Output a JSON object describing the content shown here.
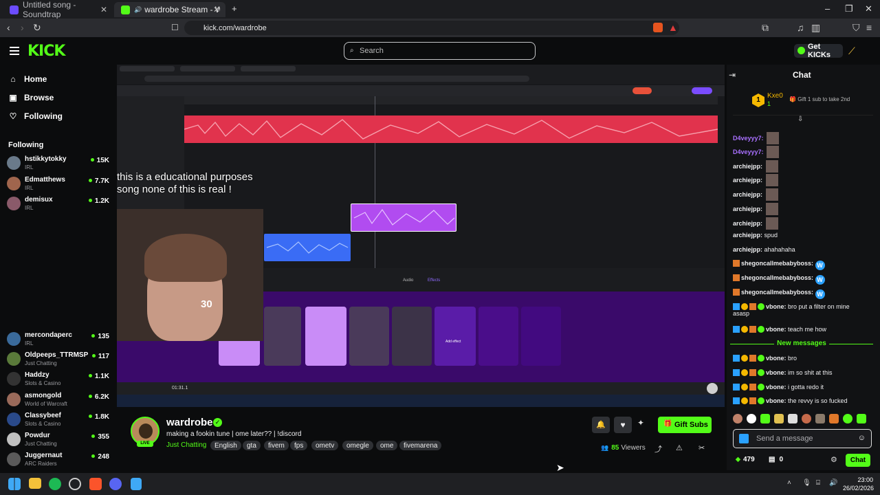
{
  "browser": {
    "tabs": [
      {
        "title": "Untitled song - Soundtrap",
        "active": false
      },
      {
        "title": "wardrobe Stream - Watch Li",
        "active": true
      }
    ],
    "url": "kick.com/wardrobe"
  },
  "header": {
    "logo": "KICK",
    "search_placeholder": "Search",
    "get_kicks_label": "Get KICKs"
  },
  "sidebar": {
    "nav": [
      {
        "label": "Home",
        "icon": "home-icon"
      },
      {
        "label": "Browse",
        "icon": "browse-icon"
      },
      {
        "label": "Following",
        "icon": "heart-icon"
      }
    ],
    "following_heading": "Following",
    "channels": [
      {
        "name": "hstikkytokky",
        "category": "IRL",
        "viewers": "15K",
        "color": "#6a7a8a"
      },
      {
        "name": "Edmatthews",
        "category": "IRL",
        "viewers": "7.7K",
        "color": "#a0654d"
      },
      {
        "name": "demisux",
        "category": "IRL",
        "viewers": "1.2K",
        "color": "#8a5a6a"
      },
      {
        "name": "mercondaperc",
        "category": "IRL",
        "viewers": "135",
        "color": "#3a6a9a"
      },
      {
        "name": "Oldpeeps_TTRMSP",
        "category": "Just Chatting",
        "viewers": "117",
        "color": "#5a7a3a"
      },
      {
        "name": "Haddzy",
        "category": "Slots & Casino",
        "viewers": "1.1K",
        "color": "#333333"
      },
      {
        "name": "asmongold",
        "category": "World of Warcraft",
        "viewers": "6.2K",
        "color": "#9a6a5a"
      },
      {
        "name": "Classybeef",
        "category": "Slots & Casino",
        "viewers": "1.8K",
        "color": "#2a4a8a"
      },
      {
        "name": "Powdur",
        "category": "Just Chatting",
        "viewers": "355",
        "color": "#c0c0c0"
      },
      {
        "name": "Juggernaut",
        "category": "ARC Raiders",
        "viewers": "248",
        "color": "#5a5a5a"
      }
    ]
  },
  "player": {
    "overlay_line1": "this is a educational purposes",
    "overlay_line2": "song none of this is real !",
    "timer_fragment": "30",
    "daw_time": "01:31.1",
    "daw_tab_audio": "Audio",
    "daw_tab_effects": "Effects",
    "add_effect": "Add effect"
  },
  "stream": {
    "streamer": "wardrobe",
    "title": "making a fookin tune | ome later?? | !discord",
    "category": "Just Chatting",
    "tags": [
      "English",
      "gta",
      "fivem",
      "fps",
      "ometv",
      "omegle",
      "ome",
      "fivemarena"
    ],
    "viewers_count": "85",
    "viewers_label": "Viewers",
    "live_badge": "LIVE",
    "gift_subs_label": "Gift Subs"
  },
  "chat": {
    "title": "Chat",
    "top_gifter": {
      "name": "Kxe0",
      "count": "1",
      "message": "Gift 1 sub to take 2nd"
    },
    "messages": [
      {
        "user": "D4veyyy7:",
        "text": "",
        "emote": true,
        "color": "#a970ff"
      },
      {
        "user": "D4veyyy7:",
        "text": "",
        "emote": true,
        "color": "#a970ff"
      },
      {
        "user": "archiejpp:",
        "text": "",
        "emote": true,
        "color": "#efeff1"
      },
      {
        "user": "archiejpp:",
        "text": "",
        "emote": true,
        "color": "#efeff1"
      },
      {
        "user": "archiejpp:",
        "text": "",
        "emote": true,
        "color": "#efeff1"
      },
      {
        "user": "archiejpp:",
        "text": "",
        "emote": true,
        "color": "#efeff1"
      },
      {
        "user": "archiejpp:",
        "text": "",
        "emote": true,
        "color": "#efeff1"
      },
      {
        "user": "archiejpp:",
        "text": "spud",
        "emote": false,
        "color": "#efeff1"
      },
      {
        "user": "archiejpp:",
        "text": "ahahahaha",
        "emote": false,
        "color": "#efeff1"
      },
      {
        "user": "shegoncallmebabyboss:",
        "text": "W",
        "emote": false,
        "color": "#efeff1"
      },
      {
        "user": "shegoncallmebabyboss:",
        "text": "W",
        "emote": false,
        "color": "#efeff1"
      },
      {
        "user": "shegoncallmebabyboss:",
        "text": "W",
        "emote": false,
        "color": "#efeff1"
      },
      {
        "user": "vbone:",
        "text": "bro put a filter on mine",
        "text2": "asasp",
        "color": "#efeff1"
      },
      {
        "user": "vbone:",
        "text": "teach me how",
        "color": "#efeff1"
      }
    ],
    "new_messages_label": "New messages",
    "new_messages": [
      {
        "user": "vbone:",
        "text": "bro"
      },
      {
        "user": "vbone:",
        "text": "im so shit at this"
      },
      {
        "user": "vbone:",
        "text": "i gotta redo it"
      },
      {
        "user": "vbone:",
        "text": "the revvy is so fucked"
      }
    ],
    "input_placeholder": "Send a message",
    "points": "479",
    "shop_count": "0",
    "send_label": "Chat"
  },
  "taskbar": {
    "time": "23:00",
    "date": "26/02/2026"
  },
  "colors": {
    "kick_green": "#53fc18",
    "background": "#0b0c0d",
    "panel": "#111214"
  }
}
